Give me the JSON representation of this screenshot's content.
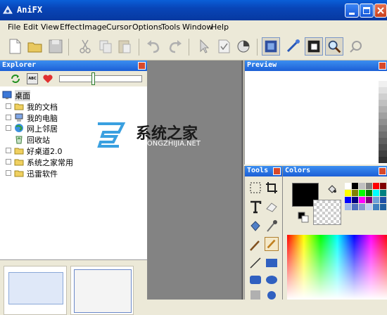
{
  "window": {
    "title": "AniFX"
  },
  "menu": [
    "File",
    "Edit",
    "View",
    "Effect",
    "Image",
    "Cursor",
    "Options",
    "Tools",
    "Window",
    "Help"
  ],
  "toolbar": {
    "icons": [
      "new-file-icon",
      "open-folder-icon",
      "save-icon",
      "cut-icon",
      "copy-icon",
      "paste-icon",
      "undo-icon",
      "redo-icon",
      "select-arrow-icon",
      "checkbox-icon",
      "circle-icon",
      "image-view-icon",
      "brush-effect-icon",
      "frame-icon",
      "zoom-icon",
      "magic-icon"
    ]
  },
  "explorer": {
    "title": "Explorer",
    "tools_abc": "ABC",
    "tree": [
      {
        "label": "桌面",
        "level": 0,
        "icon": "desktop-icon"
      },
      {
        "label": "我的文档",
        "level": 1,
        "icon": "folder-icon"
      },
      {
        "label": "我的电脑",
        "level": 1,
        "icon": "computer-icon"
      },
      {
        "label": "网上邻居",
        "level": 1,
        "icon": "network-icon"
      },
      {
        "label": "回收站",
        "level": 1,
        "icon": "recycle-bin-icon"
      },
      {
        "label": "好桌道2.0",
        "level": 1,
        "icon": "folder-icon"
      },
      {
        "label": "系统之家常用",
        "level": 1,
        "icon": "folder-icon"
      },
      {
        "label": "迅雷软件",
        "level": 1,
        "icon": "folder-icon"
      }
    ]
  },
  "watermark": {
    "main": "系统之家",
    "sub": "XITONGZHIJIA.NET"
  },
  "preview": {
    "title": "Preview"
  },
  "tools_panel": {
    "title": "Tools"
  },
  "colors_panel": {
    "title": "Colors"
  },
  "colors": {
    "foreground": "#000000",
    "palette": [
      "#ffffff",
      "#000000",
      "#c0c0c0",
      "#808080",
      "#ff0000",
      "#800000",
      "#ffff00",
      "#808000",
      "#00ff00",
      "#008000",
      "#00ffff",
      "#008080",
      "#0000ff",
      "#000080",
      "#ff00ff",
      "#800080",
      "#6fa0d8",
      "#1f4fa8",
      "#a0b8e8",
      "#5070c0",
      "#8898d0",
      "#c0d0f0",
      "#4080c0",
      "#2060a0"
    ],
    "gray_ramp": [
      "#ffffff",
      "#f0f0f0",
      "#e0e0e0",
      "#d0d0d0",
      "#c0c0c0",
      "#b0b0b0",
      "#a0a0a0",
      "#909090",
      "#808080",
      "#707070",
      "#606060",
      "#505050",
      "#404040",
      "#303030"
    ]
  }
}
